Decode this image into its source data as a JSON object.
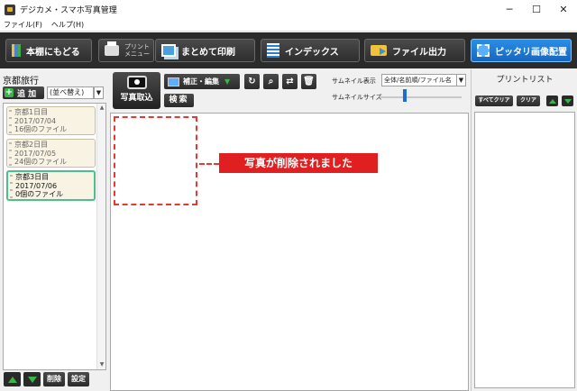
{
  "window": {
    "title": "デジカメ・スマホ写真管理",
    "controls": {
      "minimize": "─",
      "maximize": "☐",
      "close": "✕"
    }
  },
  "menu": {
    "items": [
      "ファイル(F)",
      "ヘルプ(H)"
    ]
  },
  "toolbar": {
    "back_label": "本棚にもどる",
    "print_menu_label": "プリント\nメニュー",
    "batch_print_label": "まとめて印刷",
    "index_label": "インデックス",
    "file_output_label": "ファイル出力",
    "fit_layout_label": "ピッタリ画像配置"
  },
  "left": {
    "album_title": "京都旅行",
    "add_label": "追 加",
    "sort_value": "(並べ替え)",
    "albums": [
      {
        "name": "京都1日目",
        "date": "2017/07/04",
        "count": "16個のファイル"
      },
      {
        "name": "京都2日目",
        "date": "2017/07/05",
        "count": "24個のファイル"
      },
      {
        "name": "京都3日目",
        "date": "2017/07/06",
        "count": "0個のファイル"
      }
    ],
    "delete_label": "削除",
    "settings_label": "設定"
  },
  "center": {
    "import_label": "写真取込",
    "edit_label": "補正・編集",
    "search_label": "検索",
    "thumb_display_label": "サムネイル表示",
    "thumb_display_value": "全体/名前順/ファイル名",
    "thumb_size_label": "サムネイルサイズ",
    "thumb_size_level": 0.3,
    "callout_text": "写真が削除されました"
  },
  "right": {
    "title": "プリントリスト",
    "select_all_label": "すべてクリア",
    "clear_label": "クリア"
  },
  "colors": {
    "accent_blue": "#1a6fd4",
    "callout_red": "#e02020",
    "selected_green": "#4cbf8f",
    "arrow_green": "#3cb44a"
  }
}
